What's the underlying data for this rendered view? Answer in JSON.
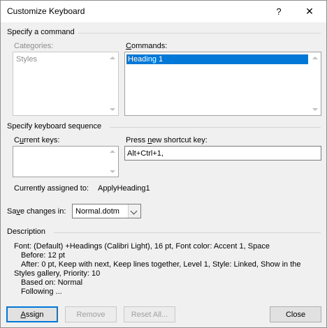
{
  "window": {
    "title": "Customize Keyboard",
    "help_glyph": "?",
    "close_glyph": "✕"
  },
  "specify_command": {
    "group_label": "Specify a command",
    "categories_label": "Categories:",
    "categories_items": [
      "Styles"
    ],
    "commands_label": "Commands:",
    "commands_items": [
      "Heading 1"
    ],
    "commands_selected": "Heading 1"
  },
  "keyboard_sequence": {
    "group_label": "Specify keyboard sequence",
    "current_keys_label": "Current keys:",
    "current_keys_items": [],
    "new_key_label": "Press new shortcut key:",
    "new_key_value": "Alt+Ctrl+1,",
    "assigned_label": "Currently assigned to:",
    "assigned_value": "ApplyHeading1"
  },
  "save_changes": {
    "label": "Save changes in:",
    "value": "Normal.dotm"
  },
  "description": {
    "group_label": "Description",
    "lines": [
      "Font: (Default) +Headings (Calibri Light), 16 pt, Font color: Accent 1, Space",
      "Before:  12 pt",
      "After:  0 pt, Keep with next, Keep lines together, Level 1, Style: Linked, Show in the",
      "Styles gallery, Priority: 10",
      "Based on: Normal",
      "Following ..."
    ]
  },
  "buttons": {
    "assign": "Assign",
    "remove": "Remove",
    "reset_all": "Reset All...",
    "close": "Close"
  }
}
